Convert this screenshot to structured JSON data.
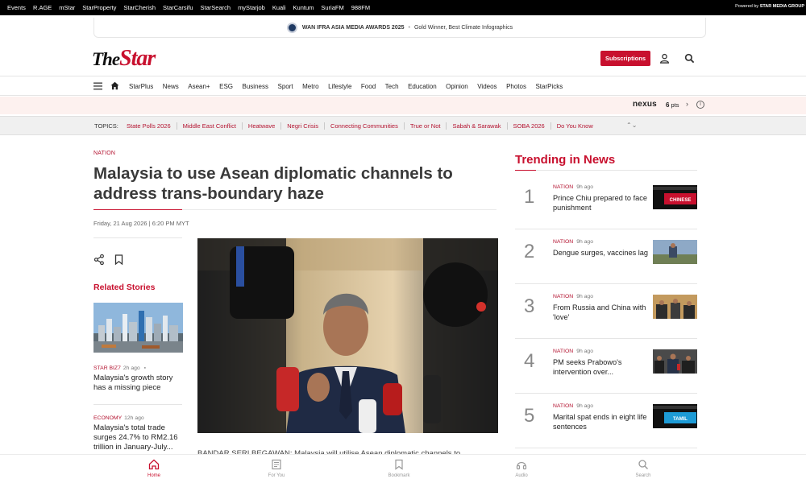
{
  "network_bar": {
    "links": [
      "Events",
      "R.AGE",
      "mStar",
      "StarProperty",
      "StarCherish",
      "StarCarsifu",
      "StarSearch",
      "myStarjob",
      "Kuali",
      "Kuntum",
      "SuriaFM",
      "988FM"
    ],
    "powered_prefix": "Powered by",
    "powered_brand": "STAR MEDIA GROUP"
  },
  "award": {
    "title": "WAN IFRA ASIA MEDIA AWARDS 2025",
    "subtitle": "Gold Winner, Best Climate Infographics"
  },
  "header": {
    "logo_the": "The",
    "logo_star": "Star",
    "subscribe_label": "Subscriptions"
  },
  "main_nav": {
    "items": [
      "StarPlus",
      "News",
      "Asean+",
      "ESG",
      "Business",
      "Sport",
      "Metro",
      "Lifestyle",
      "Food",
      "Tech",
      "Education",
      "Opinion",
      "Videos",
      "Photos",
      "StarPicks"
    ]
  },
  "nexus": {
    "brand": "nexus",
    "points": "6",
    "points_unit": "pts",
    "info": "i"
  },
  "topics": {
    "label": "TOPICS:",
    "items": [
      "State Polls 2026",
      "Middle East Conflict",
      "Heatwave",
      "Negri Crisis",
      "Connecting Communities",
      "True or Not",
      "Sabah & Sarawak",
      "SOBA 2026",
      "Do You Know"
    ]
  },
  "article": {
    "category": "NATION",
    "headline": "Malaysia to use Asean diplomatic channels to address trans-boundary haze",
    "dateline": "Friday, 21 Aug 2026 | 6:20 PM MYT",
    "body_lead": "BANDAR SERI BEGAWAN: Malaysia will utilise Asean diplomatic channels to"
  },
  "related": {
    "title": "Related Stories",
    "stories": [
      {
        "category": "STAR BIZ7",
        "ago": "2h ago",
        "title": "Malaysia's growth story has a missing piece"
      },
      {
        "category": "ECONOMY",
        "ago": "12h ago",
        "title": "Malaysia's total trade surges 24.7% to RM2.16 trillion in January-July..."
      }
    ]
  },
  "trending": {
    "title": "Trending in News",
    "items": [
      {
        "num": "1",
        "category": "NATION",
        "ago": "9h ago",
        "title": "Prince Chiu prepared to face punishment",
        "thumb_caption": "CHINESE"
      },
      {
        "num": "2",
        "category": "NATION",
        "ago": "9h ago",
        "title": "Dengue surges, vaccines lag",
        "thumb_caption": ""
      },
      {
        "num": "3",
        "category": "NATION",
        "ago": "9h ago",
        "title": "From Russia and China with 'love'",
        "thumb_caption": ""
      },
      {
        "num": "4",
        "category": "NATION",
        "ago": "9h ago",
        "title": "PM seeks Prabowo's intervention over...",
        "thumb_caption": ""
      },
      {
        "num": "5",
        "category": "NATION",
        "ago": "9h ago",
        "title": "Marital spat ends in eight life sentences",
        "thumb_caption": "TAMIL"
      }
    ]
  },
  "bottom_bar": {
    "items": [
      "Home",
      "For You",
      "Bookmark",
      "Audio",
      "Search"
    ],
    "active": "Home"
  },
  "colors": {
    "brand_red": "#c8102e",
    "link_red": "#b3122f",
    "nexus_bg": "#fdf1ef"
  }
}
